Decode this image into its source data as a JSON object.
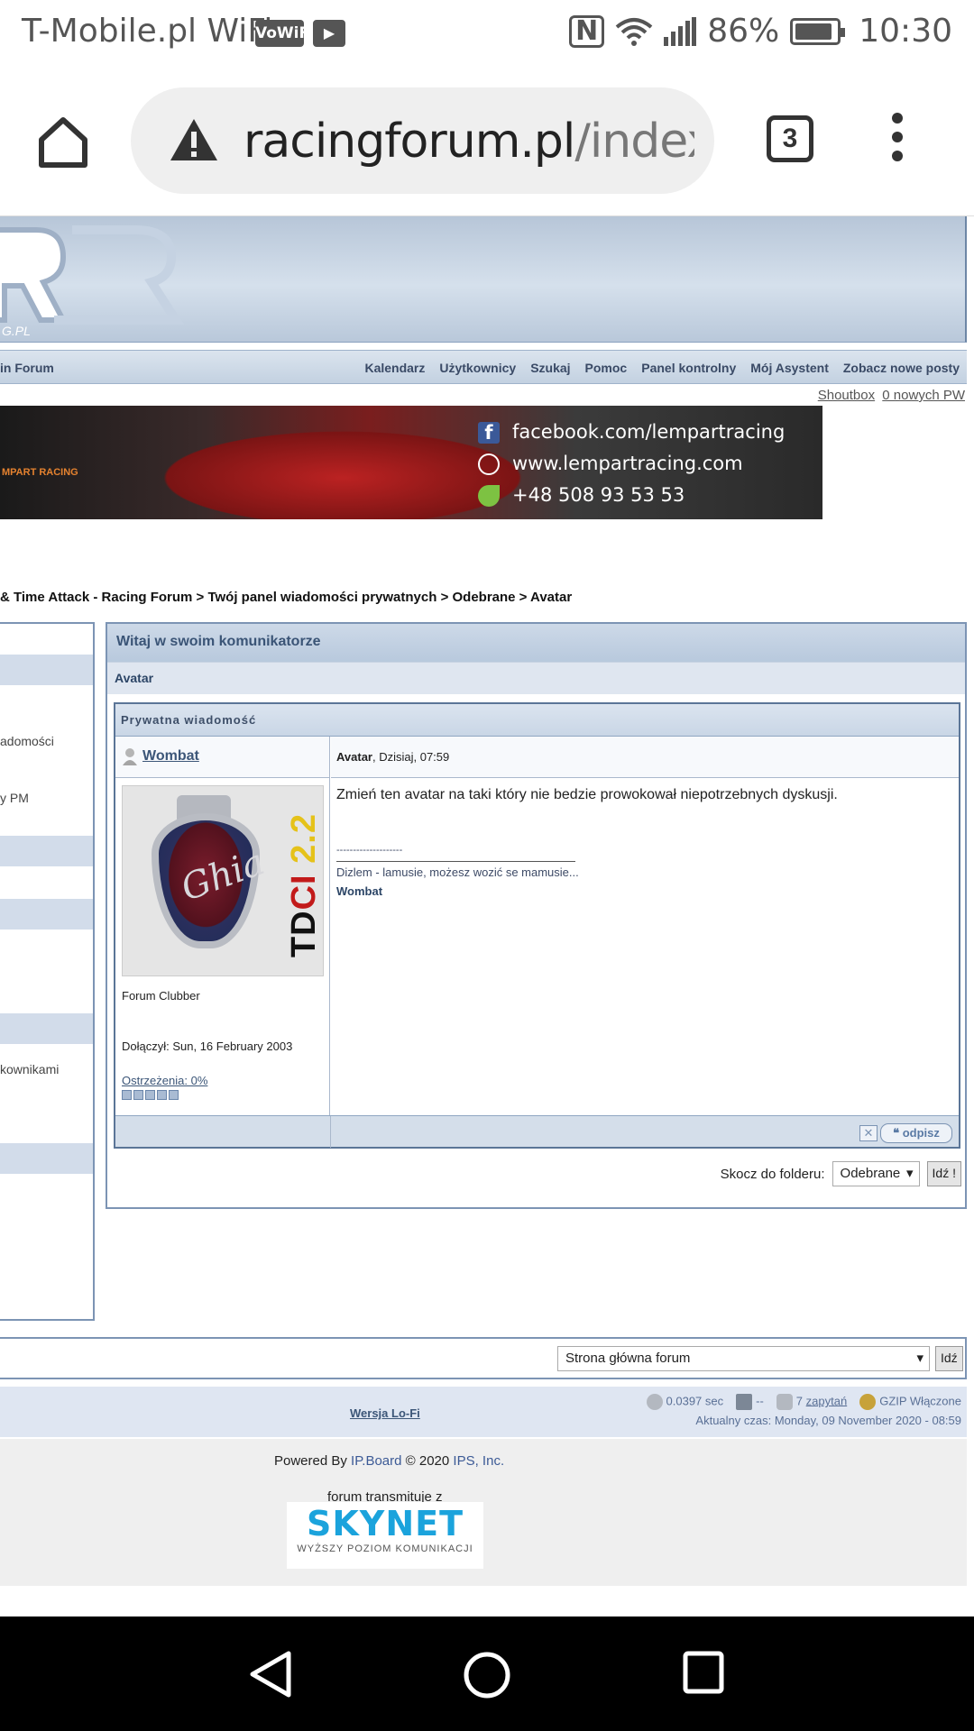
{
  "status_bar": {
    "carrier": "T-Mobile.pl WiFi",
    "vowifi": "VoWiFi",
    "battery": "86%",
    "time": "10:30"
  },
  "browser": {
    "url_host": "racingforum.pl",
    "url_path": "/index.pl",
    "tab_count": "3"
  },
  "nav": {
    "left": "in Forum",
    "links": [
      "Kalendarz",
      "Użytkownicy",
      "Szukaj",
      "Pomoc",
      "Panel kontrolny",
      "Mój Asystent",
      "Zobacz nowe posty"
    ]
  },
  "subbar": {
    "shoutbox": "Shoutbox",
    "new_pm": "0 nowych PW"
  },
  "ad": {
    "brand": "MPART RACING",
    "facebook": "facebook.com/lempartracing",
    "web": "www.lempartracing.com",
    "phone": "+48 508 93 53 53"
  },
  "breadcrumb": "& Time Attack - Racing Forum > Twój panel wiadomości prywatnych > Odebrane > Avatar",
  "sidebar": {
    "item1": "adomości",
    "item2": "y PM",
    "item3": "kownikami"
  },
  "main": {
    "title": "Witaj w swoim komunikatorze",
    "subtitle": "Avatar",
    "pm_header": "Prywatna wiadomość",
    "author": "Wombat",
    "msg_title": "Avatar",
    "msg_date": ", Dzisiaj, 07:59",
    "body": "Zmień ten avatar na taki który nie bedzie prowokował niepotrzebnych dyskusji.",
    "sig_dashes": "--------------------",
    "sig_line": "Dizlem - lamusie, możesz wozić se mamusie...",
    "sig_name": "Wombat",
    "rank": "Forum Clubber",
    "joined": "Dołączył: Sun, 16 February 2003",
    "warnings": "Ostrzeżenia: 0%",
    "reply_button": "odpisz",
    "avatar_text": {
      "t": "TD",
      "c": "CI",
      "v": "2.2",
      "ghia": "Ghia"
    }
  },
  "jump": {
    "label": "Skocz do folderu:",
    "selected": "Odebrane",
    "go": "Idź !"
  },
  "bottom": {
    "selected": "Strona główna forum",
    "go": "Idź"
  },
  "stats": {
    "lofi": "Wersja Lo-Fi",
    "time": "0.0397 sec",
    "dash": "--",
    "queries_num": "7",
    "queries": "zapytań",
    "gzip": "GZIP Włączone",
    "current_time": "Aktualny czas: Monday, 09 November 2020 - 08:59"
  },
  "footer": {
    "powered_prefix": "Powered By",
    "ipboard": "IP.Board",
    "copy": "© 2020",
    "ips": "IPS, Inc.",
    "transmit": "forum transmituje z",
    "skynet": "SKYNET",
    "skynet_tag": "WYŻSZY POZIOM KOMUNIKACJI"
  }
}
